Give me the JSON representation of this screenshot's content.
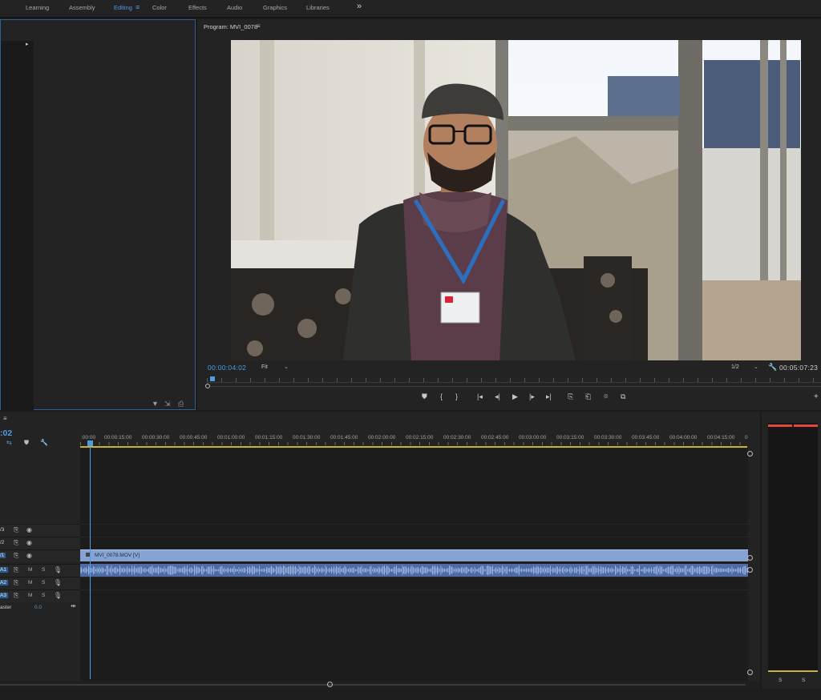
{
  "workspaces": [
    "Learning",
    "Assembly",
    "Editing",
    "Color",
    "Effects",
    "Audio",
    "Graphics",
    "Libraries"
  ],
  "active_workspace": "Editing",
  "workspace_menu_icon": "hamburger-icon",
  "workspace_more": "»",
  "program": {
    "title": "Program: MVI_0078",
    "menu": "≡",
    "timecode_current": "00:00:04:02",
    "fit": "Fit",
    "resolution": "1/2",
    "timecode_duration": "00:05:07:23",
    "caret": "⌄"
  },
  "transport": [
    "⛊",
    "{",
    "}",
    "|◂",
    "◂|",
    "▶",
    "|▸",
    "▸|",
    "⎘",
    "⎗",
    "⌾",
    "⧉"
  ],
  "timeline": {
    "menu": "≡",
    "timecode": ":02",
    "ruler_labels": [
      ":00:00",
      "00:00:15:00",
      "00:00:30:00",
      "00:00:45:00",
      "00:01:00:00",
      "00:01:15:00",
      "00:01:30:00",
      "00:01:45:00",
      "00:02:00:00",
      "00:02:15:00",
      "00:02:30:00",
      "00:02:45:00",
      "00:03:00:00",
      "00:03:15:00",
      "00:03:30:00",
      "00:03:45:00",
      "00:04:00:00",
      "00:04:15:00",
      "0"
    ],
    "tracks_video": [
      {
        "name": "/3",
        "highlight": false
      },
      {
        "name": "/2",
        "highlight": false
      },
      {
        "name": "/1",
        "highlight": true
      }
    ],
    "tracks_audio": [
      {
        "name": "A1",
        "m": "M",
        "s": "S",
        "highlight": true
      },
      {
        "name": "A2",
        "m": "M",
        "s": "S",
        "highlight": true
      },
      {
        "name": "A3",
        "m": "M",
        "s": "S",
        "highlight": true
      }
    ],
    "master_label": "aster",
    "master_value": "0.0",
    "video_clip": "MVI_0078.MOV [V]"
  },
  "meters": {
    "labels": [
      "S",
      "S"
    ],
    "peak_color": "#e2473d"
  },
  "colors": {
    "accent": "#4e9be0",
    "clip_video": "#86a3d4",
    "clip_audio": "#4f6ba3"
  }
}
